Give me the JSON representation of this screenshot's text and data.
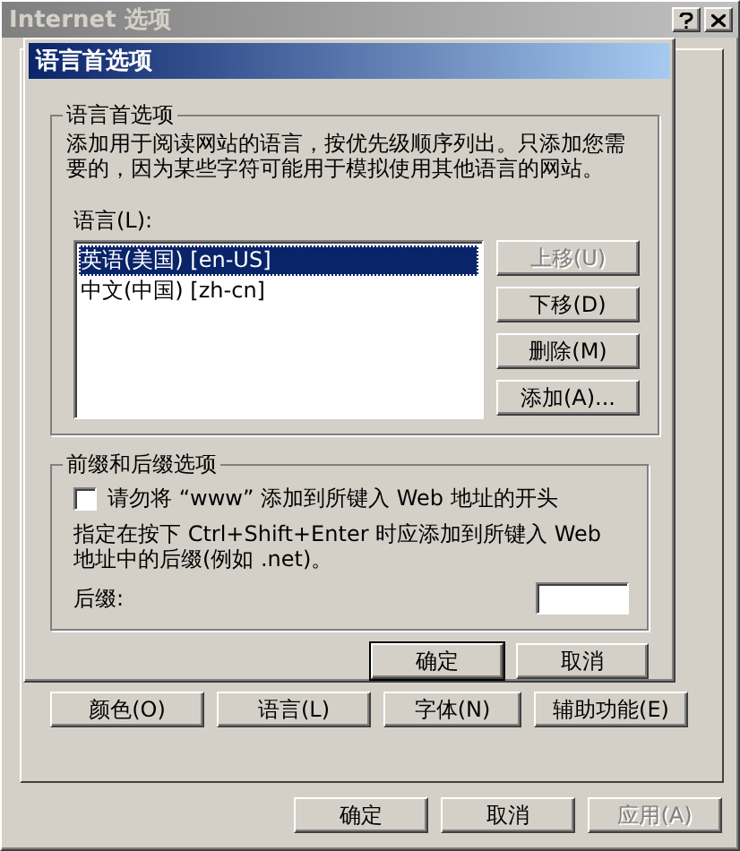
{
  "window": {
    "title": "Internet 选项",
    "active": false
  },
  "dialog": {
    "title": "语言首选项",
    "language_group": {
      "title": "语言首选项",
      "description": "添加用于阅读网站的语言，按优先级顺序列出。只添加您需要的，因为某些字符可能用于模拟使用其他语言的网站。",
      "list_label": "语言(L):",
      "languages": [
        {
          "label": "英语(美国) [en-US]",
          "selected": true
        },
        {
          "label": "中文(中国) [zh-cn]",
          "selected": false
        }
      ],
      "buttons": [
        {
          "label": "上移(U)",
          "disabled": true
        },
        {
          "label": "下移(D)",
          "disabled": false
        },
        {
          "label": "删除(M)",
          "disabled": false
        },
        {
          "label": "添加(A)...",
          "disabled": false
        }
      ]
    },
    "suffix_group": {
      "title": "前缀和后缀选项",
      "checkbox": {
        "label": "请勿将 “www” 添加到所键入 Web 地址的开头",
        "checked": false
      },
      "description": "指定在按下 Ctrl+Shift+Enter 时应添加到所键入 Web 地址中的后缀(例如 .net)。",
      "suffix_label": "后缀:"
    },
    "buttons": [
      {
        "label": "确定",
        "default": true
      },
      {
        "label": "取消",
        "default": false
      }
    ]
  },
  "appearance_buttons": [
    "颜色(O)",
    "语言(L)",
    "字体(N)",
    "辅助功能(E)"
  ],
  "buttons": [
    {
      "label": "确定",
      "disabled": false
    },
    {
      "label": "取消",
      "disabled": false
    },
    {
      "label": "应用(A)",
      "disabled": true
    }
  ]
}
